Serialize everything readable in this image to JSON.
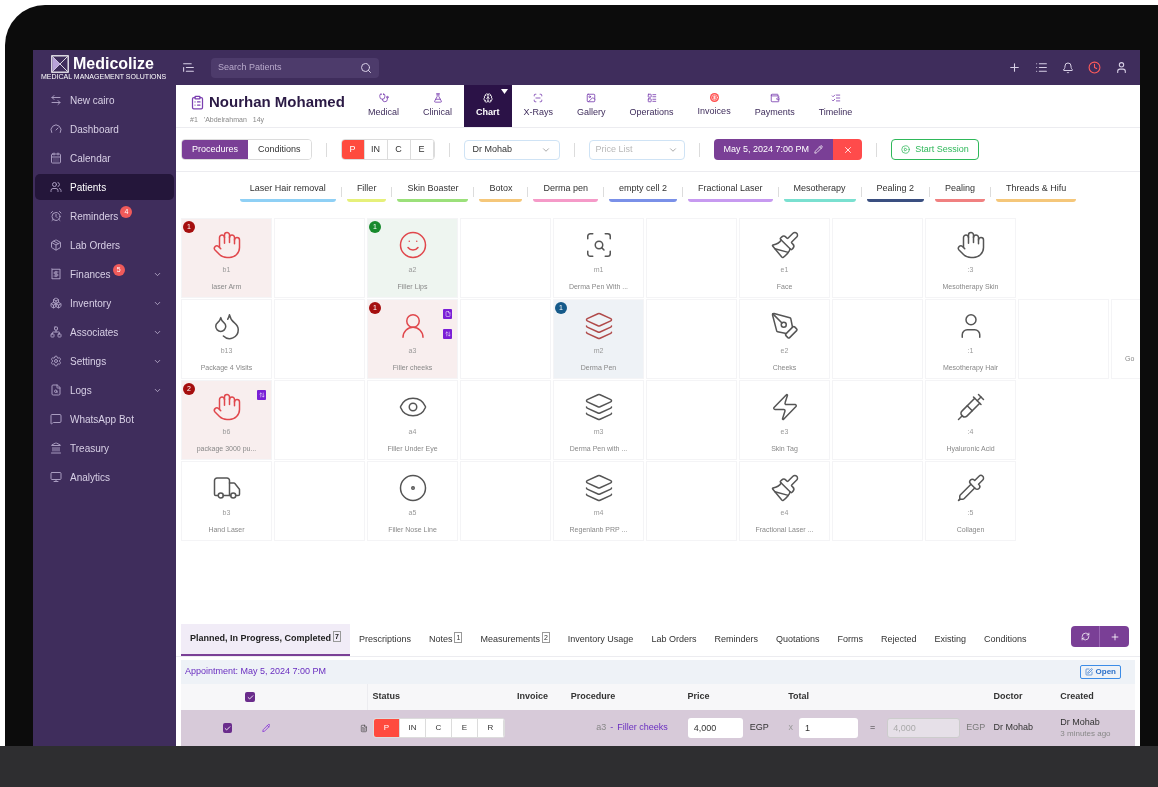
{
  "app": {
    "logo": "Medicolize",
    "tagline": "MEDICAL MANAGEMENT SOLUTIONS",
    "search": {
      "placeholder": "Search Patients"
    }
  },
  "sidebar": {
    "items": [
      {
        "label": "New cairo",
        "selected": false,
        "expandable": false
      },
      {
        "label": "Dashboard",
        "selected": false,
        "expandable": false
      },
      {
        "label": "Calendar",
        "selected": false,
        "expandable": false
      },
      {
        "label": "Patients",
        "selected": true,
        "expandable": false
      },
      {
        "label": "Reminders",
        "selected": false,
        "expandable": false,
        "badge": "4"
      },
      {
        "label": "Lab Orders",
        "selected": false,
        "expandable": false
      },
      {
        "label": "Finances",
        "selected": false,
        "expandable": true,
        "badge": "5"
      },
      {
        "label": "Inventory",
        "selected": false,
        "expandable": true
      },
      {
        "label": "Associates",
        "selected": false,
        "expandable": true
      },
      {
        "label": "Settings",
        "selected": false,
        "expandable": true
      },
      {
        "label": "Logs",
        "selected": false,
        "expandable": true
      },
      {
        "label": "WhatsApp Bot",
        "selected": false,
        "expandable": false
      },
      {
        "label": "Treasury",
        "selected": false,
        "expandable": false
      },
      {
        "label": "Analytics",
        "selected": false,
        "expandable": false
      }
    ]
  },
  "patient": {
    "name": "Nourhan Mohamed",
    "number": "#1",
    "referrer": "'Abdelrahman",
    "age": "14y"
  },
  "patient_tabs": [
    {
      "label": "Medical",
      "selected": false
    },
    {
      "label": "Clinical",
      "selected": false
    },
    {
      "label": "Chart",
      "selected": true
    },
    {
      "label": "X-Rays",
      "selected": false
    },
    {
      "label": "Gallery",
      "selected": false
    },
    {
      "label": "Operations",
      "selected": false
    },
    {
      "label": "Invoices",
      "selected": false
    },
    {
      "label": "Payments",
      "selected": false
    },
    {
      "label": "Timeline",
      "selected": false
    }
  ],
  "toolbar": {
    "mode_toggle": [
      {
        "label": "Procedures",
        "selected": true
      },
      {
        "label": "Conditions",
        "selected": false
      }
    ],
    "status_filter": [
      {
        "label": "P",
        "selected": true
      },
      {
        "label": "IN",
        "selected": false
      },
      {
        "label": "C",
        "selected": false
      },
      {
        "label": "E",
        "selected": false
      }
    ],
    "doctor": "Dr Mohab",
    "price_list": {
      "placeholder": "Price List"
    },
    "appointment": "May 5, 2024 7:00 PM",
    "start_session": "Start Session"
  },
  "categories": [
    {
      "label": "Laser Hair removal",
      "color": "#8fd0f5"
    },
    {
      "label": "Filler",
      "color": "#e6f07a"
    },
    {
      "label": "Skin Boaster",
      "color": "#9be07a"
    },
    {
      "label": "Botox",
      "color": "#f5c77a"
    },
    {
      "label": "Derma pen",
      "color": "#f59ac8"
    },
    {
      "label": "empty cell 2",
      "color": "#7a90e8"
    },
    {
      "label": "Fractional Laser",
      "color": "#c79af0"
    },
    {
      "label": "Mesotherapy",
      "color": "#7ae0d0"
    },
    {
      "label": "Pealing 2",
      "color": "#3a4f80"
    },
    {
      "label": "Pealing",
      "color": "#f08080"
    },
    {
      "label": "Threads & Hifu",
      "color": "#f5c77a"
    }
  ],
  "procedure_grid": [
    [
      {
        "code": "b1",
        "name": "laser Arm",
        "kind": "planned",
        "count": "1"
      },
      {
        "code": "a2",
        "name": "Filler Lips",
        "kind": "completed",
        "count": "1"
      },
      {
        "code": "m1",
        "name": "Derma Pen With ...",
        "kind": "plain"
      },
      {
        "code": "e1",
        "name": "Face",
        "kind": "plain"
      },
      {
        "code": ":3",
        "name": "Mesotherapy Skin",
        "kind": "plain"
      }
    ],
    [
      {
        "code": "b13",
        "name": "Package 4 Visits",
        "kind": "plain"
      },
      {
        "code": "a3",
        "name": "Filler cheeks",
        "kind": "planned",
        "count": "1",
        "markers": [
          {
            "kind": "document"
          },
          {
            "kind": "swap"
          }
        ]
      },
      {
        "code": "m2",
        "name": "Derma Pen",
        "kind": "inprogress",
        "count": "1"
      },
      {
        "code": "e2",
        "name": "Cheeks",
        "kind": "plain"
      },
      {
        "code": ":1",
        "name": "Mesotherapy Hair",
        "kind": "plain"
      },
      {
        "name": "Go",
        "kind": "partial"
      }
    ],
    [
      {
        "code": "b6",
        "name": "package 3000 pu...",
        "kind": "planned",
        "count": "2",
        "markers": [
          {
            "kind": "swap"
          }
        ]
      },
      {
        "code": "a4",
        "name": "Filler Under Eye",
        "kind": "plain"
      },
      {
        "code": "m3",
        "name": "Derma Pen with ...",
        "kind": "plain"
      },
      {
        "code": "e3",
        "name": "Skin Tag",
        "kind": "plain"
      },
      {
        "code": ":4",
        "name": "Hyaluronic Acid",
        "kind": "plain"
      }
    ],
    [
      {
        "code": "b3",
        "name": "Hand Laser",
        "kind": "plain"
      },
      {
        "code": "a5",
        "name": "Filler Nose Line",
        "kind": "plain"
      },
      {
        "code": "m4",
        "name": "Regenlanb PRP ...",
        "kind": "plain"
      },
      {
        "code": "e4",
        "name": "Fractional Laser ...",
        "kind": "plain"
      },
      {
        "code": ":5",
        "name": "Collagen",
        "kind": "plain"
      }
    ]
  ],
  "bottom_tabs": [
    {
      "label": "Planned, In Progress, Completed",
      "count": "7",
      "selected": true
    },
    {
      "label": "Prescriptions",
      "selected": false
    },
    {
      "label": "Notes",
      "count": "1",
      "selected": false
    },
    {
      "label": "Measurements",
      "count": "2",
      "selected": false
    },
    {
      "label": "Inventory Usage",
      "selected": false
    },
    {
      "label": "Lab Orders",
      "selected": false
    },
    {
      "label": "Reminders",
      "selected": false
    },
    {
      "label": "Quotations",
      "selected": false
    },
    {
      "label": "Forms",
      "selected": false
    },
    {
      "label": "Rejected",
      "selected": false
    },
    {
      "label": "Existing",
      "selected": false
    },
    {
      "label": "Conditions",
      "selected": false
    }
  ],
  "appointment_bar": {
    "label": "Appointment: May 5, 2024 7:00 PM",
    "open_button": "Open"
  },
  "table": {
    "all_checked": true,
    "columns": [
      "Status",
      "Invoice",
      "Procedure",
      "Price",
      "Total",
      "Doctor",
      "Created"
    ],
    "rows": [
      {
        "checked": true,
        "statuses": [
          {
            "label": "P",
            "selected": true
          },
          {
            "label": "IN",
            "selected": false
          },
          {
            "label": "C",
            "selected": false
          },
          {
            "label": "E",
            "selected": false
          },
          {
            "label": "R",
            "selected": false
          }
        ],
        "code": "a3",
        "separator": "-",
        "procedure": "Filler cheeks",
        "price": "4,000",
        "currency": "EGP",
        "times": "x",
        "quantity": "1",
        "equals": "=",
        "total": "4,000",
        "total_currency": "EGP",
        "doctor": "Dr Mohab",
        "created_by": "Dr Mohab",
        "created_ago": "3 minutes ago"
      }
    ]
  }
}
